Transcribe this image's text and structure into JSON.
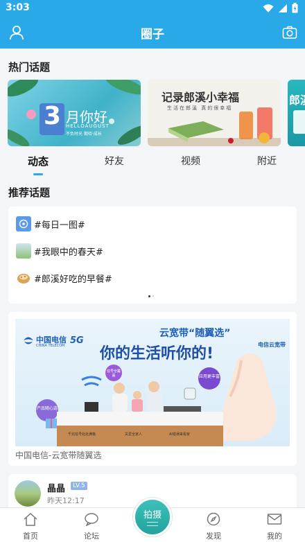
{
  "status_bar": {
    "time": "3:03"
  },
  "header": {
    "title": "圈子"
  },
  "hot_topics": {
    "title": "热门话题",
    "cards": [
      {
        "big_num": "3",
        "heading": "月你好",
        "sub_en": "HELLOAUGUST",
        "sub_cn": "不负时光 期待·成长"
      },
      {
        "heading": "记录郎溪小幸福",
        "sub": "生活在郎溪 真的很幸福"
      },
      {
        "heading": "郎溪"
      }
    ]
  },
  "tabs": [
    {
      "label": "动态",
      "active": true
    },
    {
      "label": "好友",
      "active": false
    },
    {
      "label": "视频",
      "active": false
    },
    {
      "label": "附近",
      "active": false
    }
  ],
  "recommended": {
    "title": "推荐话题",
    "items": [
      {
        "label": "#每日一图#"
      },
      {
        "label": "#我眼中的春天#"
      },
      {
        "label": "#郎溪好吃的早餐#"
      }
    ]
  },
  "ad": {
    "brand": "中国电信",
    "brand_en": "CHINA TELECOM",
    "tag_5g": "5G",
    "headline_small": "云宽带“随翼选”",
    "headline_big": "你的生活听你的!",
    "logo_right": "电信云宽带",
    "bubble_left": "产品随心选",
    "bubble_mid": "信号全覆盖",
    "bubble_right": "应用更丰富",
    "panel_items": [
      "千兆信号处处满格",
      "关爱全家人",
      "AI错误来看家"
    ],
    "caption": "中国电信-云宽带随翼选"
  },
  "post": {
    "author": "晶晶",
    "level": "LV.5",
    "time": "昨天12:17"
  },
  "bottom_nav": {
    "items": [
      {
        "label": "首页"
      },
      {
        "label": "论坛"
      },
      {
        "label": "发现"
      },
      {
        "label": "我的"
      }
    ],
    "shoot_label": "拍摄"
  },
  "colors": {
    "primary": "#2aa9e8",
    "accent_teal": "#22a39d",
    "background": "#f4f5f7"
  }
}
